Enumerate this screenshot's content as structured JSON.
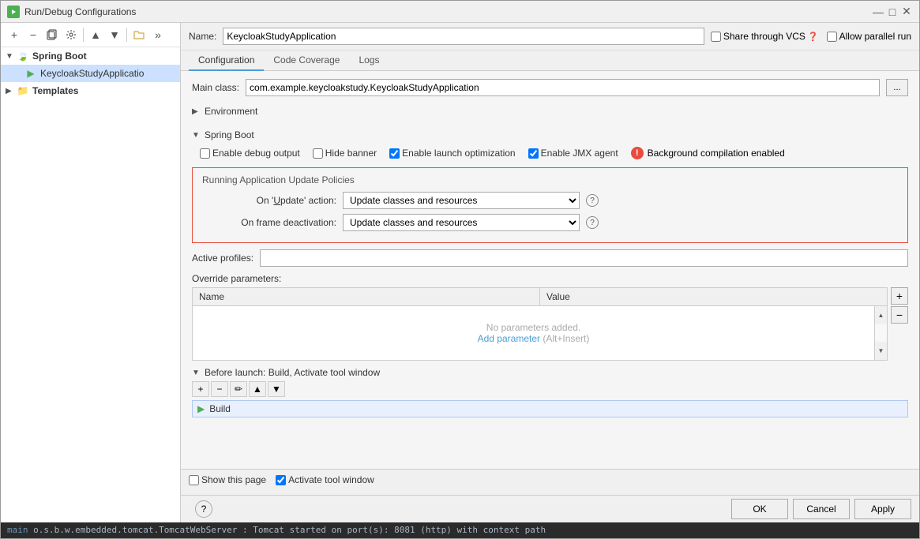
{
  "window": {
    "title": "Run/Debug Configurations",
    "close_btn": "✕",
    "min_btn": "—",
    "max_btn": "□"
  },
  "sidebar": {
    "toolbar": {
      "add": "+",
      "remove": "−",
      "copy": "⧉",
      "settings": "⚙",
      "up": "▲",
      "down": "▼",
      "more": "»"
    },
    "groups": [
      {
        "label": "Spring Boot",
        "expanded": true,
        "children": [
          {
            "label": "KeycloakStudyApplicatio",
            "selected": true
          }
        ]
      },
      {
        "label": "Templates",
        "expanded": false,
        "children": []
      }
    ]
  },
  "name_bar": {
    "name_label": "Name:",
    "name_value": "KeycloakStudyApplication",
    "share_label": "Share through VCS",
    "allow_parallel_label": "Allow parallel run"
  },
  "tabs": [
    {
      "label": "Configuration",
      "active": true
    },
    {
      "label": "Code Coverage",
      "active": false
    },
    {
      "label": "Logs",
      "active": false
    }
  ],
  "config": {
    "main_class_label": "Main class:",
    "main_class_value": "com.example.keycloakstudy.KeycloakStudyApplication",
    "browse_btn": "...",
    "env_label": "Environment",
    "spring_boot_label": "Spring Boot",
    "enable_debug_label": "Enable debug output",
    "hide_banner_label": "Hide banner",
    "enable_launch_label": "Enable launch optimization",
    "enable_jmx_label": "Enable JMX agent",
    "bg_compilation_label": "Background compilation enabled",
    "policies_title": "Running Application Update Policies",
    "on_update_label": "On 'Update' action:",
    "on_update_value": "Update classes and resources",
    "on_frame_label": "On frame deactivation:",
    "on_frame_value": "Update classes and resources",
    "active_profiles_label": "Active profiles:",
    "override_params_label": "Override parameters:",
    "params_col_name": "Name",
    "params_col_value": "Value",
    "no_params_text": "No parameters added.",
    "add_param_text": "Add parameter",
    "add_param_shortcut": "(Alt+Insert)",
    "before_launch_label": "Before launch: Build, Activate tool window",
    "build_item_label": "Build",
    "show_page_label": "Show this page",
    "activate_window_label": "Activate tool window"
  },
  "footer_buttons": {
    "ok": "OK",
    "cancel": "Can...",
    "apply": "Apply"
  },
  "terminal": {
    "prefix": "main",
    "text": "o.s.b.w.embedded.tomcat.TomcatWebServer : Tomcat started on port(s): 8081 (http) with context path"
  }
}
